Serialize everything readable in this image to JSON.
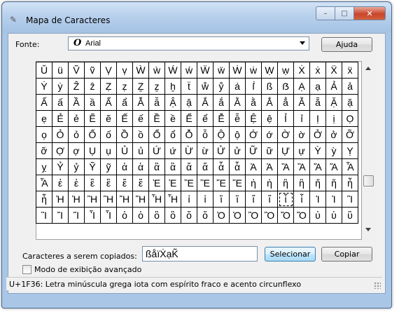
{
  "window": {
    "title": "Mapa de Caracteres"
  },
  "controls": {
    "minimize": "–",
    "maximize": "□",
    "close": "✕"
  },
  "font": {
    "label": "Fonte:",
    "icon_glyph": "O",
    "value": "Arial"
  },
  "help_button": "Ajuda",
  "grid_rows": [
    [
      "Ŭ",
      "ü",
      "Ṽ",
      "ṽ",
      "Ṿ",
      "ṿ",
      "Ẁ",
      "ẁ",
      "Ẃ",
      "ẃ",
      "Ẅ",
      "ẅ",
      "Ẇ",
      "ẇ",
      "Ẉ",
      "ẉ",
      "Ẋ",
      "ẋ",
      "Ẍ",
      "ẍ"
    ],
    [
      "Ẏ",
      "ẏ",
      "Ẑ",
      "ẑ",
      "Ẓ",
      "ẓ",
      "Ẕ",
      "ẕ",
      "ẖ",
      "ẗ",
      "ẘ",
      "ẙ",
      "ẚ",
      "ẛ",
      "ß",
      "ẞ",
      "Ạ",
      "ạ",
      "Ả",
      "ả"
    ],
    [
      "Ấ",
      "ấ",
      "Ầ",
      "ầ",
      "Ẩ",
      "ẩ",
      "Ẫ",
      "ẫ",
      "Ậ",
      "ậ",
      "Ắ",
      "ắ",
      "Ằ",
      "ằ",
      "Ẳ",
      "ẳ",
      "Ẵ",
      "ẵ",
      "Ặ",
      "ặ"
    ],
    [
      "ẹ",
      "Ẻ",
      "ẻ",
      "Ẽ",
      "ẽ",
      "Ế",
      "ế",
      "Ề",
      "ề",
      "Ể",
      "ể",
      "Ễ",
      "ễ",
      "Ệ",
      "ệ",
      "Ỉ",
      "ỉ",
      "Ị",
      "ị",
      "Ọ"
    ],
    [
      "ọ",
      "Ỏ",
      "ỏ",
      "Ố",
      "ố",
      "Ồ",
      "ồ",
      "Ổ",
      "ổ",
      "Ỗ",
      "ỗ",
      "Ộ",
      "ộ",
      "Ớ",
      "ớ",
      "Ờ",
      "ờ",
      "Ở",
      "ở",
      "Ỡ"
    ],
    [
      "ỡ",
      "Ợ",
      "ợ",
      "Ụ",
      "ụ",
      "Ủ",
      "ủ",
      "Ứ",
      "ứ",
      "Ừ",
      "ừ",
      "Ử",
      "ử",
      "Ữ",
      "ữ",
      "Ự",
      "ự",
      "Ỳ",
      "ỳ",
      "Ỵ"
    ],
    [
      "ỵ",
      "Ỷ",
      "ỷ",
      "Ỹ",
      "ỹ",
      "ἀ",
      "ἁ",
      "ἂ",
      "ἃ",
      "ἄ",
      "ἅ",
      "ἆ",
      "ἇ",
      "Ἀ",
      "Ἁ",
      "Ἂ",
      "Ἃ",
      "Ἄ",
      "Ἅ",
      "Ἆ"
    ],
    [
      "Ἇ",
      "ἐ",
      "ἑ",
      "ἒ",
      "ἓ",
      "ἔ",
      "ἕ",
      "Ἐ",
      "Ἑ",
      "Ἒ",
      "Ἓ",
      "Ἔ",
      "Ἕ",
      "ἠ",
      "ἡ",
      "ἢ",
      "ἣ",
      "ἤ",
      "ἥ",
      "ἦ"
    ],
    [
      "ἧ",
      "Ἠ",
      "Ἡ",
      "Ἢ",
      "Ἣ",
      "Ἤ",
      "Ἥ",
      "Ἦ",
      "Ἧ",
      "ἰ",
      "ἱ",
      "ἲ",
      "ἳ",
      "ἴ",
      "ἵ",
      "ἶ",
      "ἷ",
      "Ἰ",
      "Ἱ",
      "Ἲ"
    ],
    [
      "Ἳ",
      "Ἴ",
      "Ἵ",
      "Ἶ",
      "Ἷ",
      "ὀ",
      "ὁ",
      "ὂ",
      "ὃ",
      "ὄ",
      "ὅ",
      "Ὀ",
      "Ὁ",
      "Ὂ",
      "Ὃ",
      "Ὄ",
      "Ὅ",
      "ὐ",
      "ὑ",
      "ὒ"
    ]
  ],
  "selected_char": "ἶ",
  "copy": {
    "label": "Caracteres a serem copiados:",
    "value": "ßåïẊạK̃"
  },
  "select_button": "Selecionar",
  "copy_button": "Copiar",
  "advanced_view": {
    "label": "Modo de exibição avançado",
    "checked": false
  },
  "status_text": "U+1F36: Letra minúscula grega iota com espírito fraco e acento circunflexo"
}
